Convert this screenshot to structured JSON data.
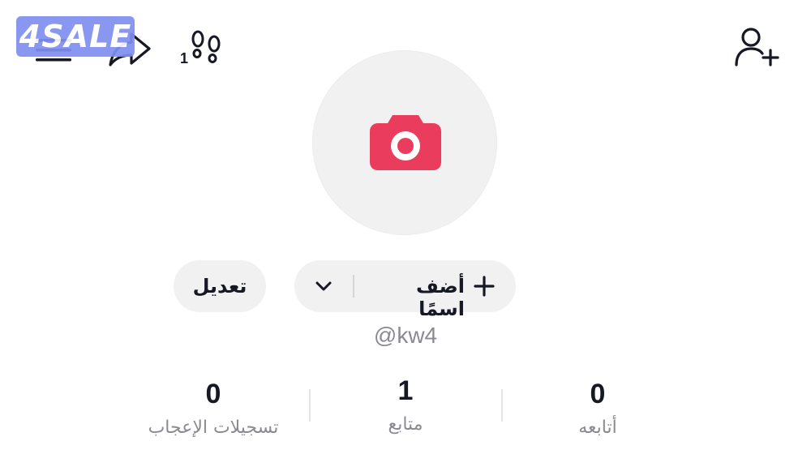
{
  "watermark": {
    "text": "4SALE"
  },
  "toolbar": {
    "menu_icon": "hamburger-icon",
    "share_icon": "share-arrow-icon",
    "visitors_icon": "footprints-icon",
    "visitors_count": "1",
    "add_friend_icon": "add-user-icon"
  },
  "profile": {
    "avatar_icon": "camera-icon",
    "add_name_label": "أضف اسمًا",
    "edit_label": "تعديل",
    "username": "@kw4"
  },
  "stats": [
    {
      "value": "0",
      "label": "أتابعه"
    },
    {
      "value": "1",
      "label": "متابع"
    },
    {
      "value": "0",
      "label": "تسجيلات الإعجاب"
    }
  ],
  "colors": {
    "accent": "#ea3d5d",
    "text": "#161823",
    "muted": "#8a8b91",
    "pill_bg": "#f1f1f2",
    "watermark_bg": "#7f8ff0"
  }
}
